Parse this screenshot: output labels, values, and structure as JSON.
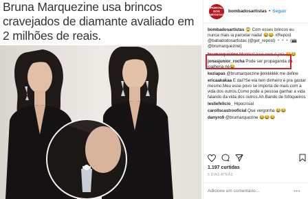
{
  "article": {
    "headline": "Bruna Marquezine usa brincos cravejados de diamante avaliado em 2 milhões de reais."
  },
  "instagram": {
    "avatar_text": "PORTAL DOS ARTISTAS",
    "username": "bombadosartistas",
    "follow_label": "Seguir",
    "comments": [
      {
        "user": "bombadosartistas",
        "text": " 😱 Com esses brincos eu nunca mais ia parcelar nada! 😂😂 #Repost @babadodosartistas (@get_repost) ・・・ (📸 @brumarquezine)"
      },
      {
        "user": "brumarquezine",
        "text": " Mentira! Isso nem é joia 😂😂"
      },
      {
        "user": "jonasjunior_rocha",
        "text": " Pode ser propaganda da joalheria né😂"
      },
      {
        "user": "keziapas",
        "text": " @brumarquezine jkkkkkkkk me define"
      },
      {
        "user": "ericaakakaa",
        "text": " E daí?Se ela tem dinheiro é pra gastar mesmo.Meu esse povo se importa de mais com a vida dos outros.Como pode a pessoa ganhar a vida falando da vida dos outros.Ah.Bando de fofoqueiros"
      },
      {
        "user": "lesliefelicio_",
        "text": " Hipocrisial"
      },
      {
        "user": "carollscastrooficial",
        "text": " Que vergonha 😂😂"
      },
      {
        "user": "danyro9",
        "text": " @brumarquezine 😂😂😂"
      }
    ],
    "likes": "1.197 curtidas",
    "time": "5 DIAS ATRÁS",
    "add_comment_placeholder": "Adicione um comentário...",
    "more_dots": "•••"
  }
}
